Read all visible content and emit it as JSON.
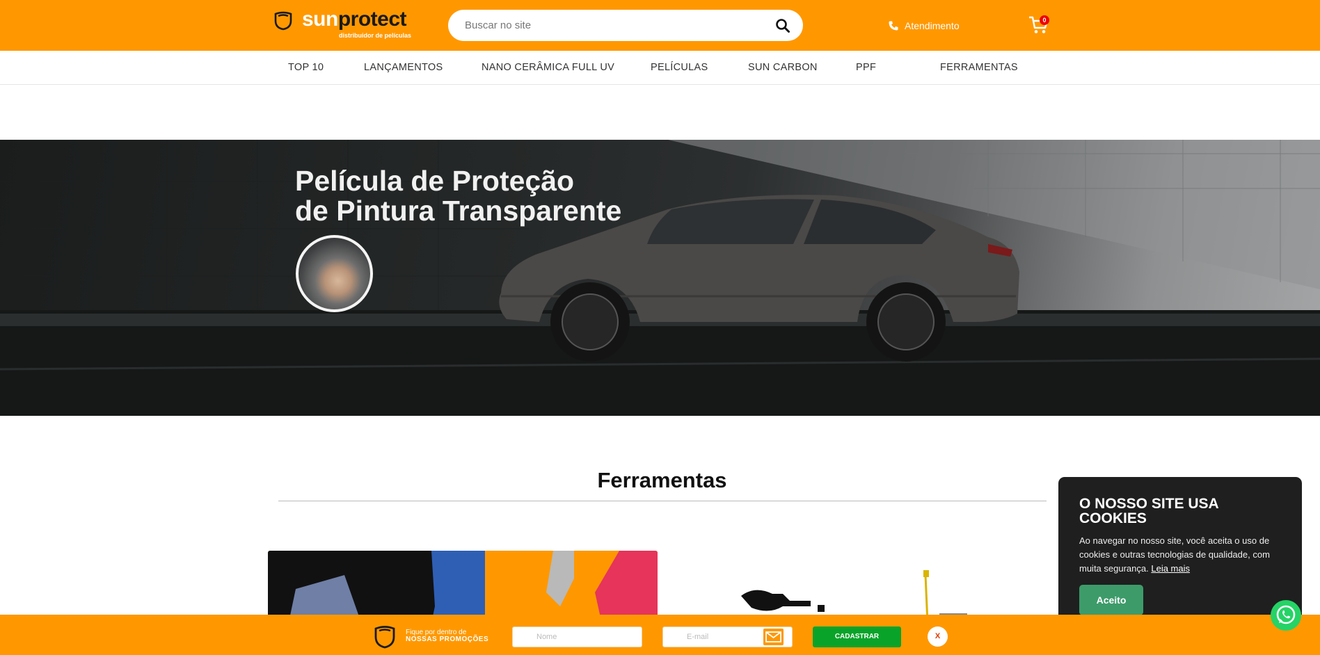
{
  "header": {
    "logo": {
      "word_a": "sun",
      "word_b": "protect",
      "subtitle": "distribuidor de películas"
    },
    "search": {
      "placeholder": "Buscar no site"
    },
    "atendimento_label": "Atendimento",
    "cart_count": "0"
  },
  "nav": {
    "items": [
      "TOP 10",
      "LANÇAMENTOS",
      "NANO CERÂMICA FULL UV",
      "PELÍCULAS",
      "SUN CARBON",
      "PPF",
      "FERRAMENTAS"
    ]
  },
  "hero": {
    "title_line1": "Película de Proteção",
    "title_line2": "de Pintura Transparente"
  },
  "section": {
    "title": "Ferramentas"
  },
  "cookie": {
    "title": "O NOSSO SITE USA COOKIES",
    "text": "Ao navegar no nosso site, você aceita o uso de cookies e outras tecnologias de qualidade, com muita segurança.",
    "link": "Leia mais",
    "accept": "Aceito"
  },
  "newsletter": {
    "line1": "Fique por dentro de",
    "line2": "NOSSAS PROMOÇÕES",
    "name_placeholder": "Nome",
    "email_placeholder": "E-mail",
    "submit": "CADASTRAR",
    "close": "X"
  },
  "colors": {
    "brand": "#ff9800",
    "cookie_bg": "#1f1f1f",
    "accept": "#3d9b6a",
    "submit": "#0aa32a",
    "whatsapp": "#25d366"
  }
}
